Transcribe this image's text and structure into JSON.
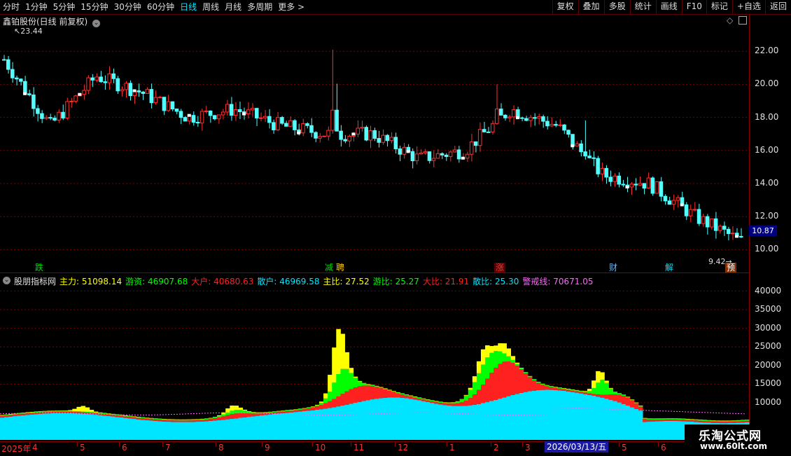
{
  "toolbar": {
    "periods": [
      "分时",
      "1分钟",
      "5分钟",
      "15分钟",
      "30分钟",
      "60分钟",
      "日线",
      "周线",
      "月线",
      "多周期",
      "更多 >"
    ],
    "active_period": "日线",
    "buttons": [
      "复权",
      "叠加",
      "多股",
      "统计",
      "画线",
      "F10",
      "标记",
      "+自选",
      "返回"
    ]
  },
  "main_panel": {
    "title": "鑫铂股份(日线 前复权)",
    "high_label": "23.44",
    "low_label": "9.42",
    "current_price": "10.87",
    "y_ticks": [
      "22.00",
      "20.00",
      "18.00",
      "16.00",
      "14.00",
      "12.00",
      "10.00"
    ],
    "signals": [
      {
        "text": "跌",
        "color": "#00dd00"
      },
      {
        "text": "减",
        "color": "#00dd00"
      },
      {
        "text": "聘",
        "color": "#ffcc00"
      },
      {
        "text": "涨",
        "color": "#ff3030"
      },
      {
        "text": "财",
        "color": "#5ab8ff"
      },
      {
        "text": "解",
        "color": "#00e5ff"
      },
      {
        "text": "预",
        "color": "#ffcc00"
      }
    ]
  },
  "indicator_panel": {
    "name": "股朋指标网",
    "values": [
      {
        "label": "主力: 51098.14",
        "color": "#ffff00"
      },
      {
        "label": "游资: 46907.68",
        "color": "#00ff00"
      },
      {
        "label": "大户: 40680.63",
        "color": "#ff2020"
      },
      {
        "label": "散户: 46969.58",
        "color": "#00e5ff"
      },
      {
        "label": "主比: 27.52",
        "color": "#ffff00"
      },
      {
        "label": "游比: 25.27",
        "color": "#00ff00"
      },
      {
        "label": "大比: 21.91",
        "color": "#ff2020"
      },
      {
        "label": "散比: 25.30",
        "color": "#00e5ff"
      },
      {
        "label": "警戒线: 70671.05",
        "color": "#ff66ff"
      }
    ],
    "y_ticks": [
      "40000",
      "35000",
      "30000",
      "25000",
      "20000",
      "15000",
      "10000"
    ]
  },
  "time_axis": {
    "labels": [
      "2025年",
      "4",
      "5",
      "6",
      "7",
      "8",
      "9",
      "10",
      "11",
      "12",
      "1",
      "2",
      "3",
      "4",
      "5",
      "6"
    ],
    "cursor_date": "2026/03/13/五"
  },
  "watermark": {
    "title": "乐淘公式网",
    "url": "www.60lt.com"
  },
  "chart_data": [
    {
      "type": "candlestick",
      "title": "鑫铂股份(日线 前复权)",
      "ylim": [
        9,
        24
      ],
      "y_ticks": [
        10,
        12,
        14,
        16,
        18,
        20,
        22
      ],
      "months": [
        "2025年3月",
        "4",
        "5",
        "6",
        "7",
        "8",
        "9",
        "10",
        "11",
        "12",
        "1",
        "2",
        "3",
        "4",
        "5",
        "6"
      ],
      "close_by_month": [
        21.5,
        17.5,
        20.5,
        19.5,
        18.0,
        18.5,
        17.5,
        17.0,
        17.0,
        15.5,
        16.0,
        18.5,
        17.5,
        14.5,
        14.0,
        12.0,
        10.5
      ],
      "annotations": {
        "high": 23.44,
        "low": 9.42,
        "last": 10.87
      }
    },
    {
      "type": "area",
      "title": "股朋指标网",
      "ylim": [
        0,
        42000
      ],
      "y_ticks": [
        10000,
        15000,
        20000,
        25000,
        30000,
        35000,
        40000
      ],
      "series": [
        {
          "name": "主力",
          "color": "#ffff00",
          "last": 51098.14
        },
        {
          "name": "游资",
          "color": "#00ff00",
          "last": 46907.68
        },
        {
          "name": "大户",
          "color": "#ff2020",
          "last": 40680.63
        },
        {
          "name": "散户",
          "color": "#00e5ff",
          "last": 46969.58
        },
        {
          "name": "警戒线",
          "color": "#ff66ff",
          "last": 70671.05
        }
      ]
    }
  ]
}
